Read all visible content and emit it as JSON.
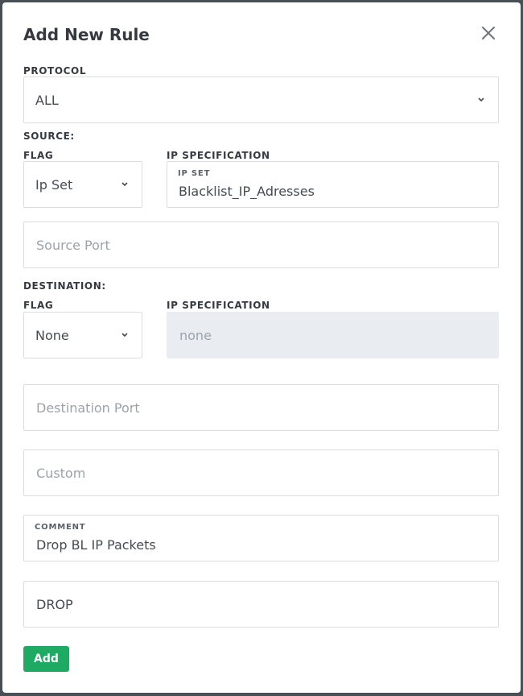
{
  "dialog": {
    "title": "Add New Rule",
    "close_icon": "close-icon"
  },
  "protocol": {
    "label": "PROTOCOL",
    "value": "ALL"
  },
  "source": {
    "section_label": "SOURCE:",
    "flag_label": "FLAG",
    "flag_value": "Ip Set",
    "ipspec_label": "IP SPECIFICATION",
    "ipset_caption": "IP SET",
    "ipset_value": "Blacklist_IP_Adresses",
    "port_placeholder": "Source Port"
  },
  "destination": {
    "section_label": "DESTINATION:",
    "flag_label": "FLAG",
    "flag_value": "None",
    "ipspec_label": "IP SPECIFICATION",
    "ipspec_placeholder": "none",
    "port_placeholder": "Destination Port"
  },
  "custom": {
    "placeholder": "Custom"
  },
  "comment": {
    "caption": "COMMENT",
    "value": "Drop BL IP Packets"
  },
  "action": {
    "value": "DROP"
  },
  "add_button": {
    "label": "Add"
  },
  "colors": {
    "accent_green": "#1eaa63",
    "disabled_bg": "#e9edf1",
    "border": "#d9dde2"
  }
}
